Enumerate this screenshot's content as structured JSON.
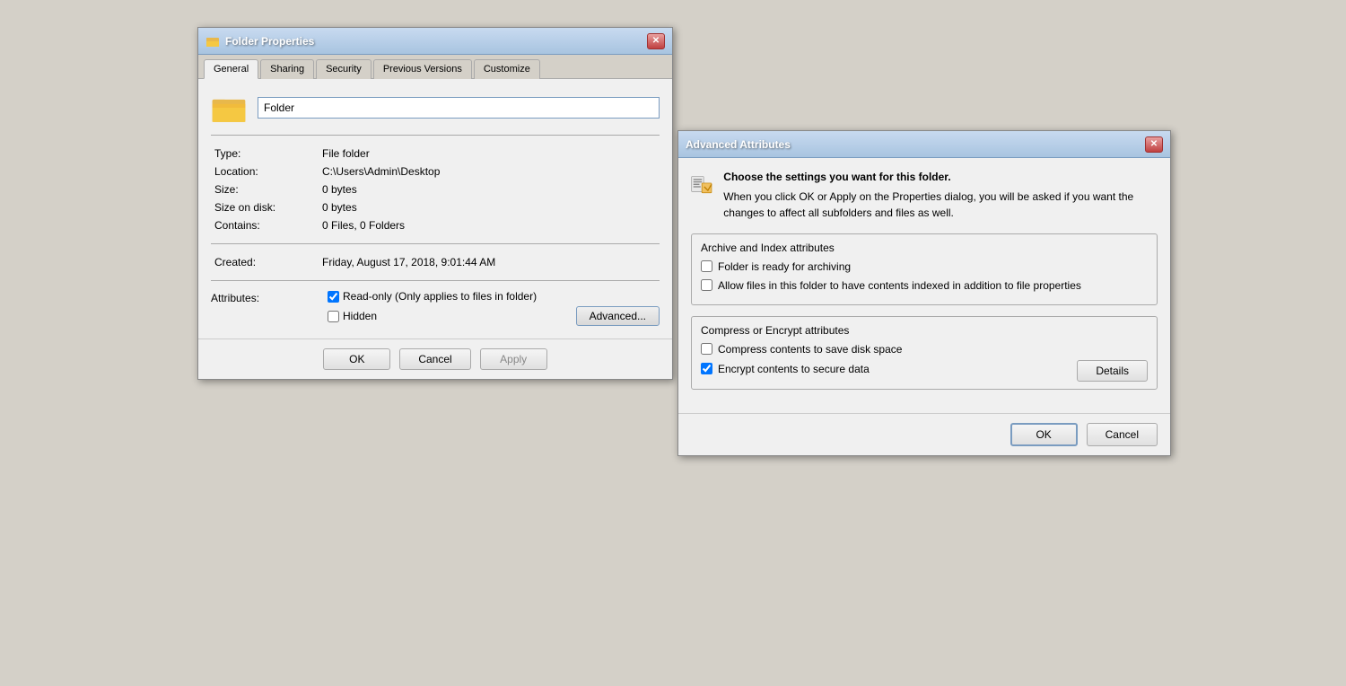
{
  "folderProps": {
    "title": "Folder Properties",
    "tabs": [
      {
        "label": "General",
        "active": true
      },
      {
        "label": "Sharing",
        "active": false
      },
      {
        "label": "Security",
        "active": false
      },
      {
        "label": "Previous Versions",
        "active": false
      },
      {
        "label": "Customize",
        "active": false
      }
    ],
    "folderName": "Folder",
    "properties": [
      {
        "label": "Type:",
        "value": "File folder"
      },
      {
        "label": "Location:",
        "value": "C:\\Users\\Admin\\Desktop"
      },
      {
        "label": "Size:",
        "value": "0 bytes"
      },
      {
        "label": "Size on disk:",
        "value": "0 bytes"
      },
      {
        "label": "Contains:",
        "value": "0 Files, 0 Folders"
      },
      {
        "label": "Created:",
        "value": "Friday, August 17, 2018, 9:01:44 AM"
      }
    ],
    "attributes": {
      "label": "Attributes:",
      "readOnly": {
        "checked": true,
        "label": "Read-only (Only applies to files in folder)"
      },
      "hidden": {
        "checked": false,
        "label": "Hidden"
      },
      "advancedBtn": "Advanced..."
    },
    "buttons": {
      "ok": "OK",
      "cancel": "Cancel",
      "apply": "Apply"
    }
  },
  "advancedAttrs": {
    "title": "Advanced Attributes",
    "description1": "Choose the settings you want for this folder.",
    "description2": "When you click OK or Apply on the Properties dialog, you will be asked if you want the changes to affect all subfolders and files as well.",
    "sections": [
      {
        "title": "Archive and Index attributes",
        "items": [
          {
            "checked": false,
            "label": "Folder is ready for archiving"
          },
          {
            "checked": false,
            "label": "Allow files in this folder to have contents indexed in addition to file properties"
          }
        ]
      },
      {
        "title": "Compress or Encrypt attributes",
        "items": [
          {
            "checked": false,
            "label": "Compress contents to save disk space"
          },
          {
            "checked": true,
            "label": "Encrypt contents to secure data"
          }
        ]
      }
    ],
    "detailsBtn": "Details",
    "buttons": {
      "ok": "OK",
      "cancel": "Cancel"
    }
  }
}
